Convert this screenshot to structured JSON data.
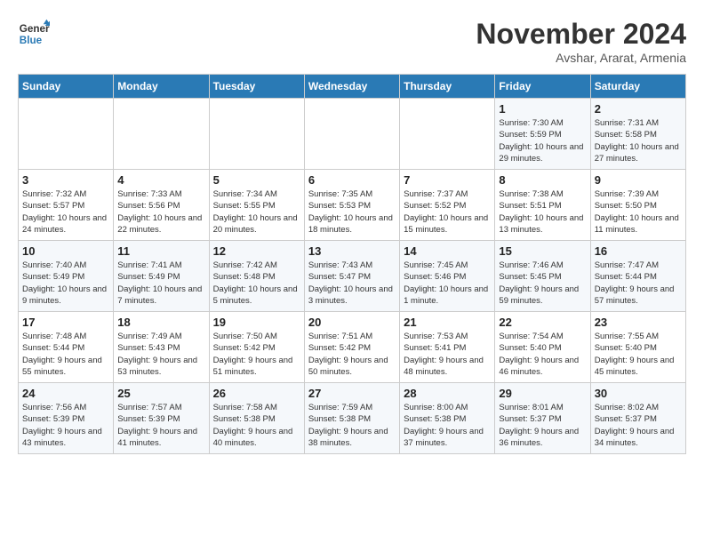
{
  "logo": {
    "line1": "General",
    "line2": "Blue"
  },
  "title": "November 2024",
  "location": "Avshar, Ararat, Armenia",
  "weekdays": [
    "Sunday",
    "Monday",
    "Tuesday",
    "Wednesday",
    "Thursday",
    "Friday",
    "Saturday"
  ],
  "weeks": [
    [
      {
        "day": "",
        "info": ""
      },
      {
        "day": "",
        "info": ""
      },
      {
        "day": "",
        "info": ""
      },
      {
        "day": "",
        "info": ""
      },
      {
        "day": "",
        "info": ""
      },
      {
        "day": "1",
        "info": "Sunrise: 7:30 AM\nSunset: 5:59 PM\nDaylight: 10 hours and 29 minutes."
      },
      {
        "day": "2",
        "info": "Sunrise: 7:31 AM\nSunset: 5:58 PM\nDaylight: 10 hours and 27 minutes."
      }
    ],
    [
      {
        "day": "3",
        "info": "Sunrise: 7:32 AM\nSunset: 5:57 PM\nDaylight: 10 hours and 24 minutes."
      },
      {
        "day": "4",
        "info": "Sunrise: 7:33 AM\nSunset: 5:56 PM\nDaylight: 10 hours and 22 minutes."
      },
      {
        "day": "5",
        "info": "Sunrise: 7:34 AM\nSunset: 5:55 PM\nDaylight: 10 hours and 20 minutes."
      },
      {
        "day": "6",
        "info": "Sunrise: 7:35 AM\nSunset: 5:53 PM\nDaylight: 10 hours and 18 minutes."
      },
      {
        "day": "7",
        "info": "Sunrise: 7:37 AM\nSunset: 5:52 PM\nDaylight: 10 hours and 15 minutes."
      },
      {
        "day": "8",
        "info": "Sunrise: 7:38 AM\nSunset: 5:51 PM\nDaylight: 10 hours and 13 minutes."
      },
      {
        "day": "9",
        "info": "Sunrise: 7:39 AM\nSunset: 5:50 PM\nDaylight: 10 hours and 11 minutes."
      }
    ],
    [
      {
        "day": "10",
        "info": "Sunrise: 7:40 AM\nSunset: 5:49 PM\nDaylight: 10 hours and 9 minutes."
      },
      {
        "day": "11",
        "info": "Sunrise: 7:41 AM\nSunset: 5:49 PM\nDaylight: 10 hours and 7 minutes."
      },
      {
        "day": "12",
        "info": "Sunrise: 7:42 AM\nSunset: 5:48 PM\nDaylight: 10 hours and 5 minutes."
      },
      {
        "day": "13",
        "info": "Sunrise: 7:43 AM\nSunset: 5:47 PM\nDaylight: 10 hours and 3 minutes."
      },
      {
        "day": "14",
        "info": "Sunrise: 7:45 AM\nSunset: 5:46 PM\nDaylight: 10 hours and 1 minute."
      },
      {
        "day": "15",
        "info": "Sunrise: 7:46 AM\nSunset: 5:45 PM\nDaylight: 9 hours and 59 minutes."
      },
      {
        "day": "16",
        "info": "Sunrise: 7:47 AM\nSunset: 5:44 PM\nDaylight: 9 hours and 57 minutes."
      }
    ],
    [
      {
        "day": "17",
        "info": "Sunrise: 7:48 AM\nSunset: 5:44 PM\nDaylight: 9 hours and 55 minutes."
      },
      {
        "day": "18",
        "info": "Sunrise: 7:49 AM\nSunset: 5:43 PM\nDaylight: 9 hours and 53 minutes."
      },
      {
        "day": "19",
        "info": "Sunrise: 7:50 AM\nSunset: 5:42 PM\nDaylight: 9 hours and 51 minutes."
      },
      {
        "day": "20",
        "info": "Sunrise: 7:51 AM\nSunset: 5:42 PM\nDaylight: 9 hours and 50 minutes."
      },
      {
        "day": "21",
        "info": "Sunrise: 7:53 AM\nSunset: 5:41 PM\nDaylight: 9 hours and 48 minutes."
      },
      {
        "day": "22",
        "info": "Sunrise: 7:54 AM\nSunset: 5:40 PM\nDaylight: 9 hours and 46 minutes."
      },
      {
        "day": "23",
        "info": "Sunrise: 7:55 AM\nSunset: 5:40 PM\nDaylight: 9 hours and 45 minutes."
      }
    ],
    [
      {
        "day": "24",
        "info": "Sunrise: 7:56 AM\nSunset: 5:39 PM\nDaylight: 9 hours and 43 minutes."
      },
      {
        "day": "25",
        "info": "Sunrise: 7:57 AM\nSunset: 5:39 PM\nDaylight: 9 hours and 41 minutes."
      },
      {
        "day": "26",
        "info": "Sunrise: 7:58 AM\nSunset: 5:38 PM\nDaylight: 9 hours and 40 minutes."
      },
      {
        "day": "27",
        "info": "Sunrise: 7:59 AM\nSunset: 5:38 PM\nDaylight: 9 hours and 38 minutes."
      },
      {
        "day": "28",
        "info": "Sunrise: 8:00 AM\nSunset: 5:38 PM\nDaylight: 9 hours and 37 minutes."
      },
      {
        "day": "29",
        "info": "Sunrise: 8:01 AM\nSunset: 5:37 PM\nDaylight: 9 hours and 36 minutes."
      },
      {
        "day": "30",
        "info": "Sunrise: 8:02 AM\nSunset: 5:37 PM\nDaylight: 9 hours and 34 minutes."
      }
    ]
  ]
}
